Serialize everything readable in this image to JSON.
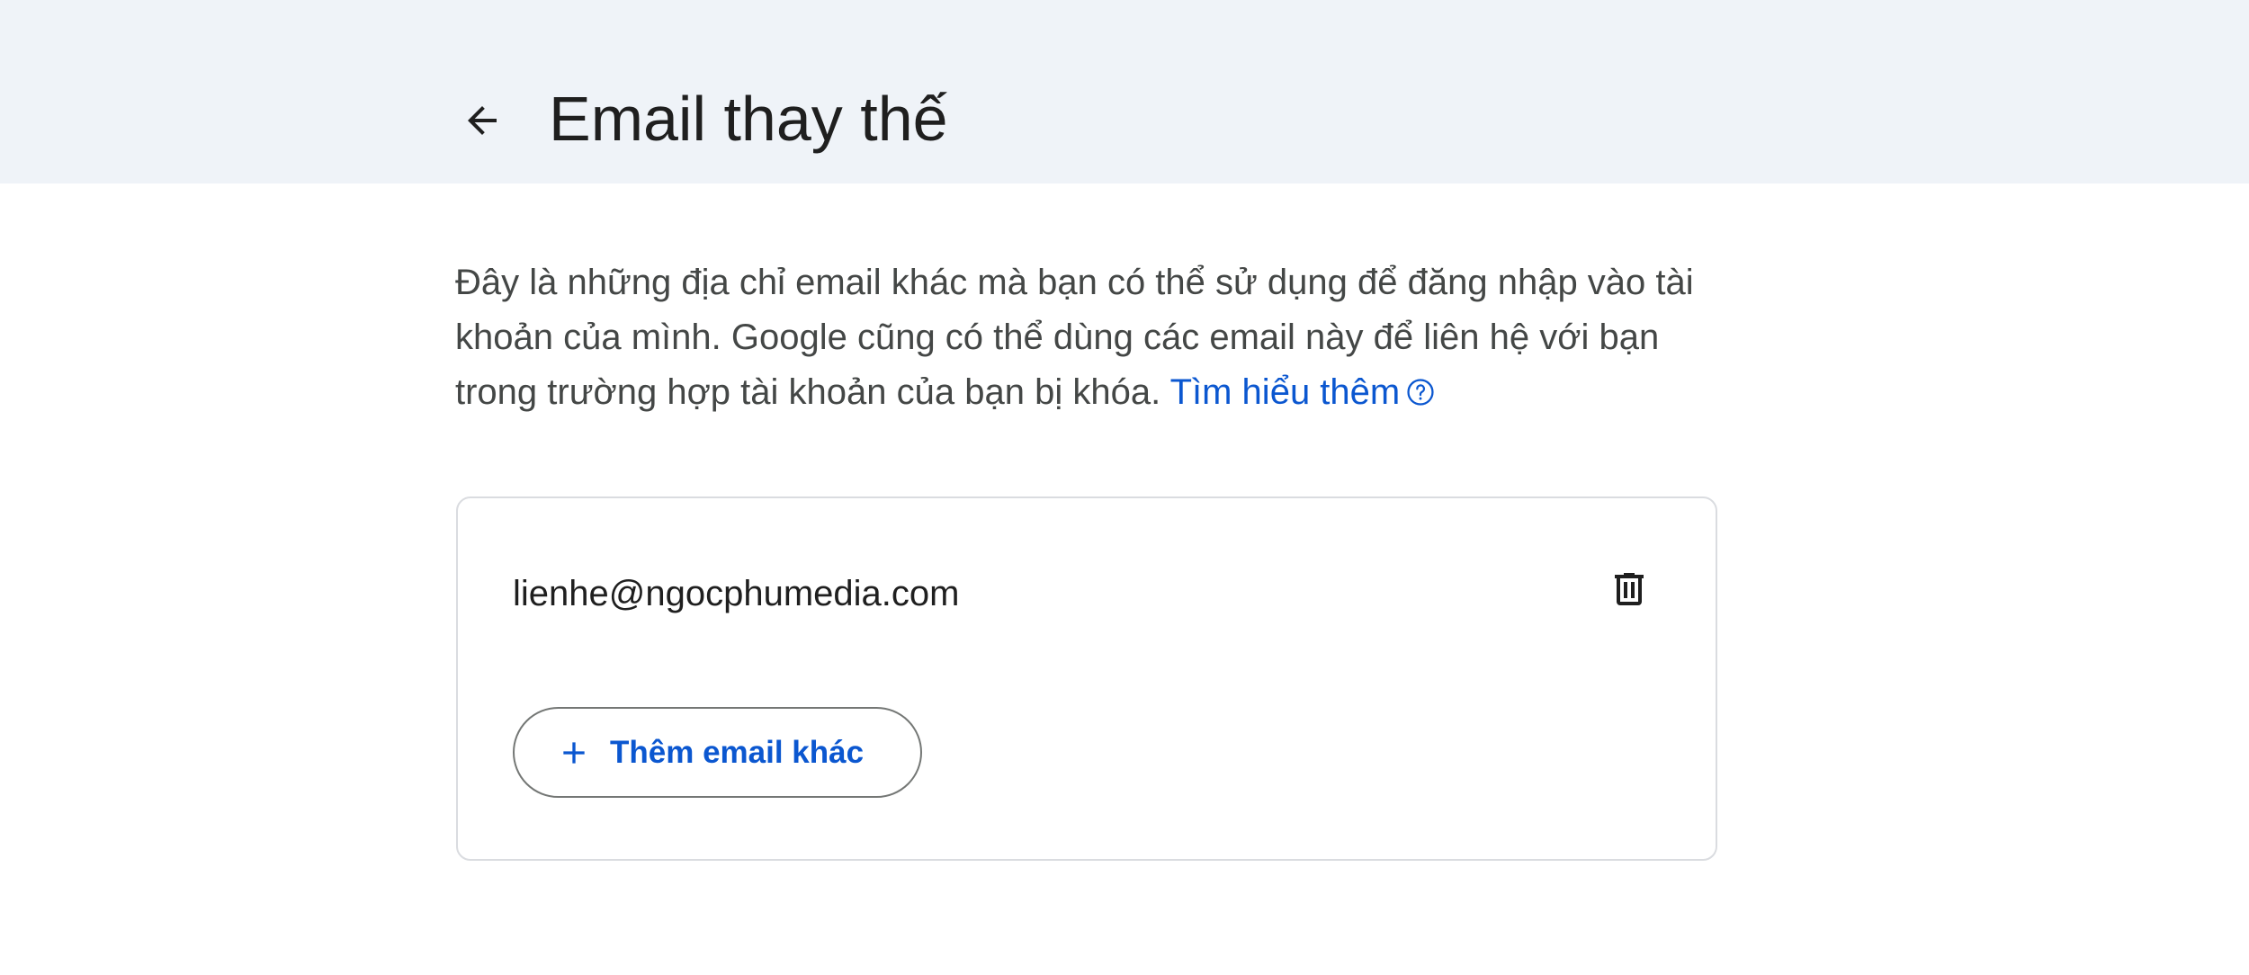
{
  "header": {
    "title": "Email thay thế",
    "back_icon": "arrow-left-icon"
  },
  "description": {
    "text": "Đây là những địa chỉ email khác mà bạn có thể sử dụng để đăng nhập vào tài khoản của mình. Google cũng có thể dùng các email này để liên hệ với bạn trong trường hợp tài khoản của bạn bị khóa.",
    "learn_more_label": "Tìm hiểu thêm",
    "help_icon": "help-circle-icon"
  },
  "emails": {
    "items": [
      {
        "address": "lienhe@ngocphumedia.com",
        "action_icon": "trash-icon"
      }
    ],
    "add_button_label": "Thêm email khác",
    "add_icon": "plus-icon"
  },
  "colors": {
    "header_bg": "#eff3f8",
    "accent": "#0b57d0",
    "text_primary": "#1f1f1f",
    "text_secondary": "#444746",
    "border": "#dadce0"
  }
}
